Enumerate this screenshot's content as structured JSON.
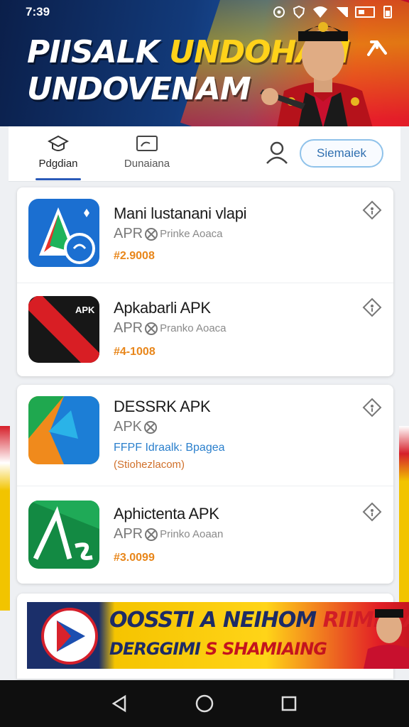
{
  "status_bar": {
    "time": "7:39"
  },
  "hero": {
    "title_part1": "PIISALK",
    "title_part2": "UNDOHAM",
    "title_line2": "UNDOVENAM"
  },
  "tabs": [
    {
      "label": "Pdgdian",
      "icon": "graduation-cap-icon",
      "active": true
    },
    {
      "label": "Dunaiana",
      "icon": "image-frame-icon",
      "active": false
    }
  ],
  "search": {
    "label": "Siemaiek"
  },
  "apps": [
    {
      "name": "Mani lustanani vlapi",
      "meta_prefix": "APR",
      "meta_suffix": "Prinke Aoaca",
      "price": "#2.9008"
    },
    {
      "name": "Apkabarli APK",
      "meta_prefix": "APR",
      "meta_suffix": "Pranko Aoaca",
      "price": "#4-1008"
    },
    {
      "name": "DESSRK APK",
      "meta_prefix": "APK",
      "link": "FFPF Idraalk: Bpagea",
      "sub": "(Stiohezlacom)"
    },
    {
      "name": "Aphictenta APK",
      "meta_prefix": "APR",
      "meta_suffix": "Prinko Aoaan",
      "price": "#3.0099"
    }
  ],
  "ad": {
    "line1_part1": "OOSSTI",
    "line1_part2": "A NEIHOM",
    "line1_part3": "RIIMIAIA",
    "line2_part1": "DERGGIMI",
    "line2_part2": "S SHAMIAING"
  },
  "colors": {
    "accent": "#2a5ab8",
    "price": "#e8861a",
    "link": "#2a7fcc",
    "flag_red": "#d61f2a",
    "flag_yellow": "#f2c400"
  }
}
